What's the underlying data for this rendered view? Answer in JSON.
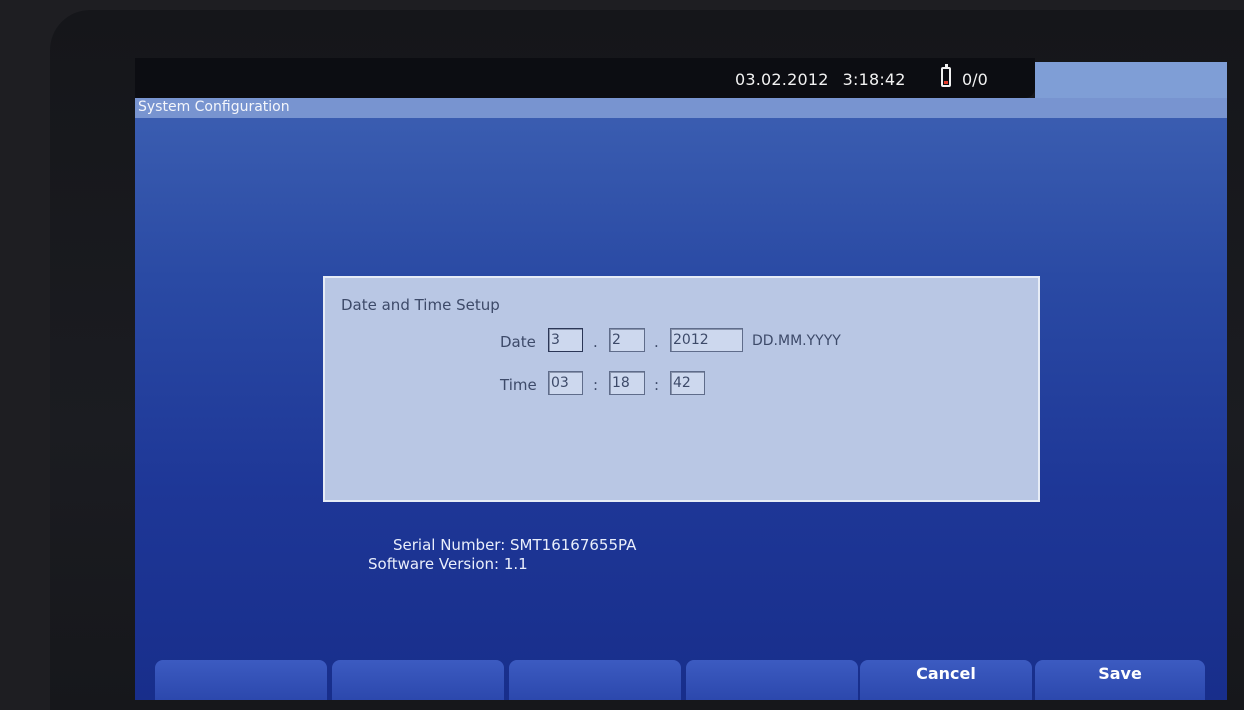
{
  "status": {
    "date": "03.02.2012",
    "time": "3:18:42",
    "battery_icon": "battery-low-icon",
    "battery_count": "0/0"
  },
  "window": {
    "title": "System Configuration"
  },
  "dialog": {
    "title": "Date and Time Setup",
    "date": {
      "label": "Date",
      "day": "3",
      "month": "2",
      "year": "2012",
      "separator": ".",
      "format": "DD.MM.YYYY"
    },
    "time": {
      "label": "Time",
      "hours": "03",
      "minutes": "18",
      "seconds": "42",
      "separator": ":"
    }
  },
  "info": {
    "serial": "Serial Number: SMT16167655PA",
    "software": "Software Version: 1.1"
  },
  "softkeys": {
    "key1": "",
    "key2": "",
    "key3": "",
    "key4": "",
    "cancel": "Cancel",
    "save": "Save"
  },
  "colors": {
    "screen_blue": "#2a4aa4",
    "title_bar": "#7894d0",
    "dialog_bg": "#b9c7e4",
    "battery_red": "#e03a2c"
  }
}
